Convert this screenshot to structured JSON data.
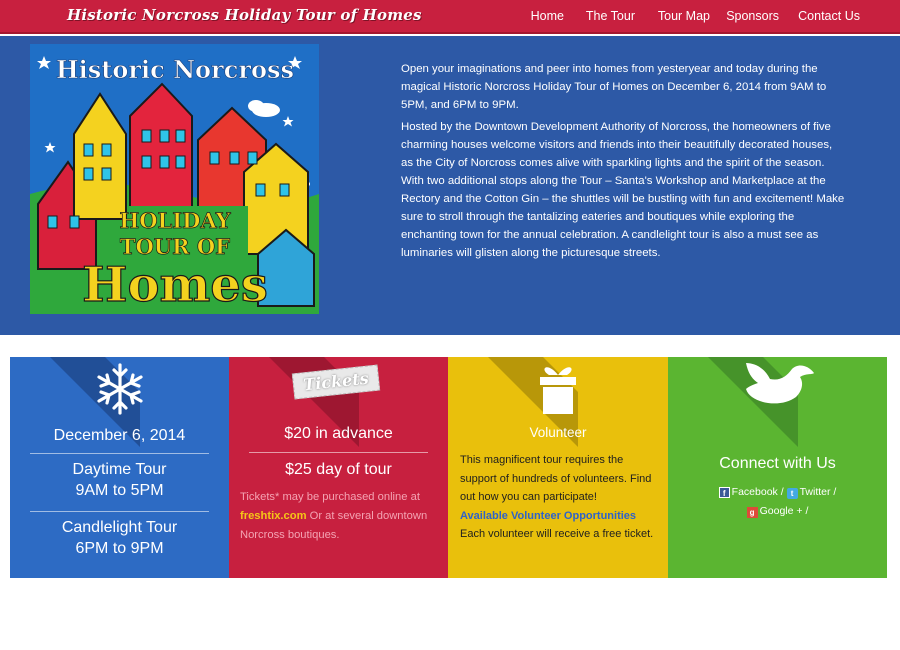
{
  "header": {
    "site_title": "Historic Norcross Holiday Tour of Homes",
    "nav": [
      {
        "label": "Home"
      },
      {
        "label": "The Tour"
      },
      {
        "label": "Tour Map"
      },
      {
        "label": "Sponsors"
      },
      {
        "label": "Contact Us"
      }
    ]
  },
  "poster": {
    "top_text": "Historic Norcross",
    "line1": "HOLIDAY",
    "line2": "TOUR OF",
    "line3": "Homes"
  },
  "intro": {
    "paragraph1": "Open your imaginations and peer into homes from yesteryear and today during the magical Historic Norcross Holiday Tour of Homes on December 6, 2014 from 9AM to 5PM, and 6PM to 9PM.",
    "paragraph2": "Hosted by the Downtown Development Authority of Norcross, the homeowners of five charming houses welcome visitors and friends into their beautifully decorated houses, as the City of Norcross comes alive with sparkling lights and the spirit of the season. With two additional stops along the Tour – Santa's Workshop and Marketplace at the Rectory and the Cotton Gin – the shuttles will be bustling with fun and excitement! Make sure to stroll through the tantalizing eateries and boutiques while exploring the enchanting town for the annual celebration. A candlelight tour is also a must see as luminaries will glisten along the picturesque streets."
  },
  "date_box": {
    "icon": "snowflake-icon",
    "date": "December 6, 2014",
    "daytime_title": "Daytime Tour",
    "daytime_hours": "9AM to 5PM",
    "candle_title": "Candlelight Tour",
    "candle_hours": "6PM to 9PM"
  },
  "tickets_box": {
    "badge": "Tickets",
    "advance": "$20 in advance",
    "day_of": "$25 day of tour",
    "text_before": "Tickets* may be purchased online at",
    "link": "freshtix.com",
    "text_after": "Or at several downtown Norcross boutiques."
  },
  "volunteer_box": {
    "icon": "gift-icon",
    "heading": "Volunteer",
    "text_before": "This magnificent tour requires the support of hundreds of volunteers. Find out how you can participate!",
    "link": "Available Volunteer Opportunities",
    "text_after": "Each volunteer will receive a free ticket."
  },
  "connect_box": {
    "icon": "dove-icon",
    "heading": "Connect with Us",
    "facebook": "Facebook",
    "twitter": "Twitter",
    "googleplus": "Google +",
    "sep": "/"
  },
  "colors": {
    "header_red": "#c8203f",
    "hero_blue": "#2d59a6",
    "date_blue": "#2d6bc4",
    "tickets_red": "#c7203f",
    "volunteer_yellow": "#e9c00c",
    "connect_green": "#5bb531"
  }
}
